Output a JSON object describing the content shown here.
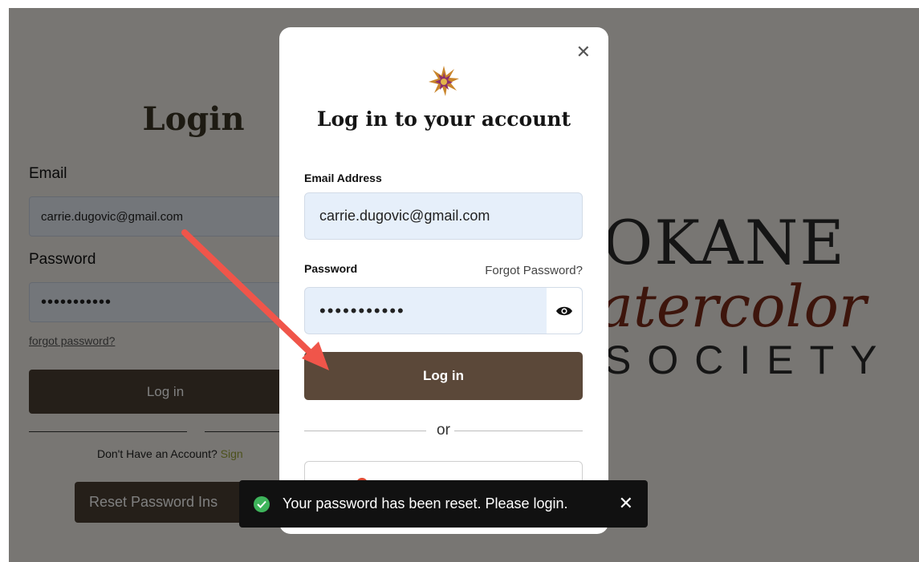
{
  "background_page": {
    "title": "Login",
    "email_label": "Email",
    "email_value": "carrie.dugovic@gmail.com",
    "password_label": "Password",
    "password_value": "•••••••••••",
    "forgot_link": "forgot password?",
    "login_button": "Log in",
    "signup_prompt": "Don't Have an Account?",
    "signup_link": "Sign",
    "reset_button": "Reset Password Ins",
    "logo_line1": "OKANE",
    "logo_line2": "atercolor",
    "logo_line3": "SOCIETY"
  },
  "modal": {
    "close_icon": "close-icon",
    "title": "Log in to your account",
    "email_label": "Email Address",
    "email_value": "carrie.dugovic@gmail.com",
    "password_label": "Password",
    "forgot_link": "Forgot Password?",
    "password_value": "•••••••••••",
    "eye_icon": "eye-icon",
    "login_button": "Log in",
    "or_text": "or",
    "accent_color": "#5b4839"
  },
  "toast": {
    "message": "Your password has been reset. Please login.",
    "icon": "check-circle-icon",
    "close_icon": "close-icon",
    "icon_color": "#3eb45b"
  },
  "annotation": {
    "arrow_color": "#f0554a"
  }
}
